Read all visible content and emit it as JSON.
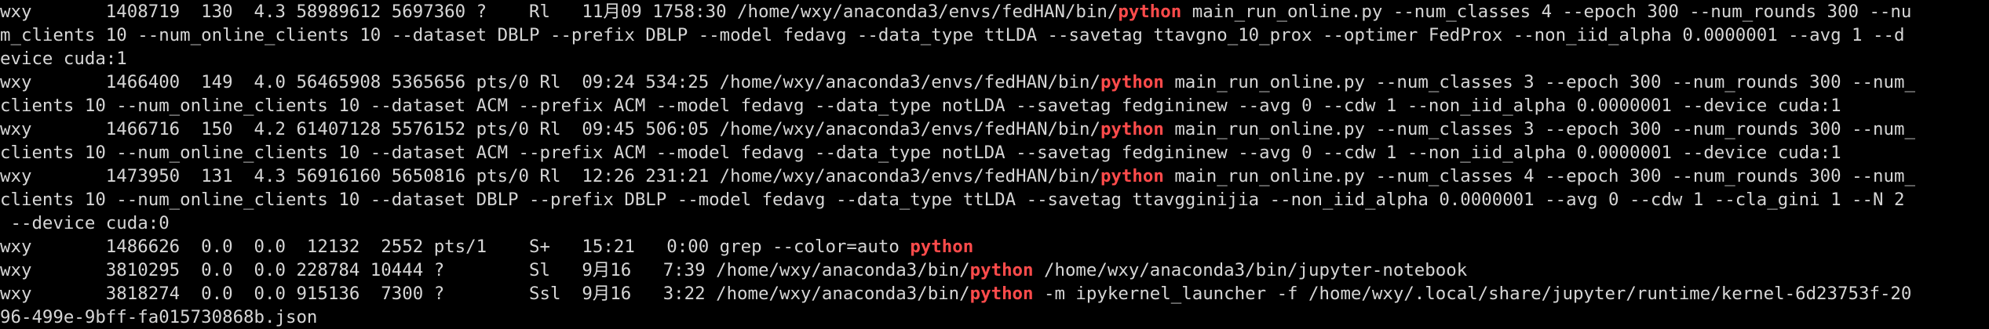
{
  "terminal": {
    "highlight_color": "#ff4b4b",
    "text_color": "#d6d6d6",
    "background": "#000000",
    "lines": [
      [
        {
          "t": "wxy       1408719  130  4.3 58989612 5697360 ?    Rl   11月09 1758:30 /home/wxy/anaconda3/envs/fedHAN/bin/",
          "h": false
        },
        {
          "t": "python",
          "h": true
        },
        {
          "t": " main_run_online.py --num_classes 4 --epoch 300 --num_rounds 300 --nu",
          "h": false
        }
      ],
      [
        {
          "t": "m_clients 10 --num_online_clients 10 --dataset DBLP --prefix DBLP --model fedavg --data_type ttLDA --savetag ttavgno_10_prox --optimer FedProx --non_iid_alpha 0.0000001 --avg 1 --d",
          "h": false
        }
      ],
      [
        {
          "t": "evice cuda:1",
          "h": false
        }
      ],
      [
        {
          "t": "wxy       1466400  149  4.0 56465908 5365656 pts/0 Rl  09:24 534:25 /home/wxy/anaconda3/envs/fedHAN/bin/",
          "h": false
        },
        {
          "t": "python",
          "h": true
        },
        {
          "t": " main_run_online.py --num_classes 3 --epoch 300 --num_rounds 300 --num_",
          "h": false
        }
      ],
      [
        {
          "t": "clients 10 --num_online_clients 10 --dataset ACM --prefix ACM --model fedavg --data_type notLDA --savetag fedgininew --avg 0 --cdw 1 --non_iid_alpha 0.0000001 --device cuda:1",
          "h": false
        }
      ],
      [
        {
          "t": "wxy       1466716  150  4.2 61407128 5576152 pts/0 Rl  09:45 506:05 /home/wxy/anaconda3/envs/fedHAN/bin/",
          "h": false
        },
        {
          "t": "python",
          "h": true
        },
        {
          "t": " main_run_online.py --num_classes 3 --epoch 300 --num_rounds 300 --num_",
          "h": false
        }
      ],
      [
        {
          "t": "clients 10 --num_online_clients 10 --dataset ACM --prefix ACM --model fedavg --data_type notLDA --savetag fedgininew --avg 0 --cdw 1 --non_iid_alpha 0.0000001 --device cuda:1",
          "h": false
        }
      ],
      [
        {
          "t": "wxy       1473950  131  4.3 56916160 5650816 pts/0 Rl  12:26 231:21 /home/wxy/anaconda3/envs/fedHAN/bin/",
          "h": false
        },
        {
          "t": "python",
          "h": true
        },
        {
          "t": " main_run_online.py --num_classes 4 --epoch 300 --num_rounds 300 --num_",
          "h": false
        }
      ],
      [
        {
          "t": "clients 10 --num_online_clients 10 --dataset DBLP --prefix DBLP --model fedavg --data_type ttLDA --savetag ttavgginijia --non_iid_alpha 0.0000001 --avg 0 --cdw 1 --cla_gini 1 --N 2",
          "h": false
        }
      ],
      [
        {
          "t": " --device cuda:0",
          "h": false
        }
      ],
      [
        {
          "t": "wxy       1486626  0.0  0.0  12132  2552 pts/1    S+   15:21   0:00 grep --color=auto ",
          "h": false
        },
        {
          "t": "python",
          "h": true
        }
      ],
      [
        {
          "t": "wxy       3810295  0.0  0.0 228784 10444 ?        Sl   9月16   7:39 /home/wxy/anaconda3/bin/",
          "h": false
        },
        {
          "t": "python",
          "h": true
        },
        {
          "t": " /home/wxy/anaconda3/bin/jupyter-notebook",
          "h": false
        }
      ],
      [
        {
          "t": "wxy       3818274  0.0  0.0 915136  7300 ?        Ssl  9月16   3:22 /home/wxy/anaconda3/bin/",
          "h": false
        },
        {
          "t": "python",
          "h": true
        },
        {
          "t": " -m ipykernel_launcher -f /home/wxy/.local/share/jupyter/runtime/kernel-6d23753f-20",
          "h": false
        }
      ],
      [
        {
          "t": "96-499e-9bff-fa015730868b.json",
          "h": false
        }
      ]
    ]
  }
}
